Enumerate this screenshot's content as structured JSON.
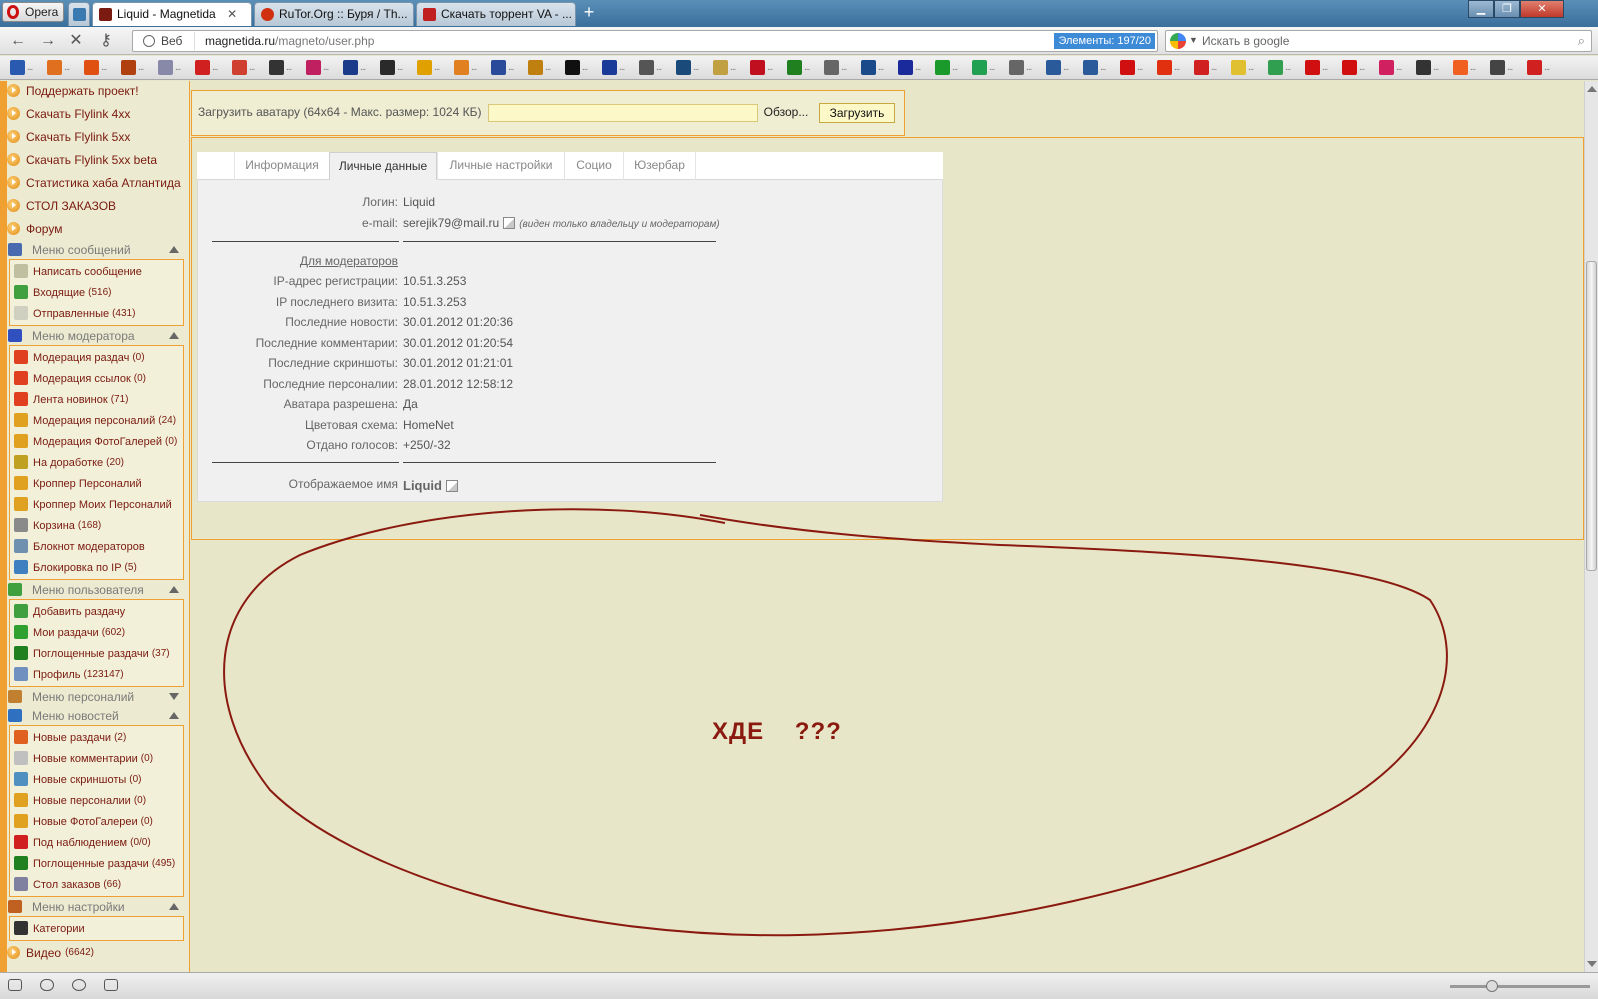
{
  "browser": {
    "menu_label": "Opera",
    "tabs": [
      {
        "label": "Liquid - Magnetida",
        "active": true,
        "color": "#7a1a10"
      },
      {
        "label": "RuTor.Org :: Буря / Th...",
        "active": false,
        "color": "#d03010"
      },
      {
        "label": "Скачать торрент VA - ...",
        "active": false,
        "color": "#c02020"
      }
    ],
    "new_tab": "+",
    "address": {
      "scheme_label": "Веб",
      "host": "magnetida.ru",
      "path": "/magneto/user.php",
      "counter": "Элементы: 197/20"
    },
    "search_placeholder": "Искать в google"
  },
  "bookmark_colors": [
    "#2a5ab0",
    "#e07020",
    "#e05010",
    "#b04010",
    "#8888a8",
    "#d02020",
    "#d04030",
    "#333333",
    "#c02060",
    "#1a3a8a",
    "#2a2a2a",
    "#e0a000",
    "#e08020",
    "#2a4a9a",
    "#c08010",
    "#101010",
    "#1a3a9a",
    "#555555",
    "#1a4a7a",
    "#c0a040",
    "#c01020",
    "#208020",
    "#666666",
    "#1a4a8a",
    "#1a2a9a",
    "#1a9a2a",
    "#20a050",
    "#666666",
    "#2a5a9a",
    "#2a5a9a",
    "#d01010",
    "#e03010",
    "#d02020",
    "#e0c030",
    "#30a050",
    "#d01010",
    "#d01010",
    "#d02060",
    "#333333",
    "#f06020",
    "#444444",
    "#d02020"
  ],
  "sidebar": {
    "top_links": [
      "Поддержать проект!",
      "Скачать Flylink 4xx",
      "Скачать Flylink 5xx",
      "Скачать Flylink 5xx beta",
      "Статистика хаба Атлантида",
      "СТОЛ ЗАКАЗОВ",
      "Форум"
    ],
    "menus": [
      {
        "title": "Меню сообщений",
        "open": true,
        "color": "#4a6ab0",
        "items": [
          {
            "label": "Написать сообщение",
            "count": "",
            "color": "#c0c0a0"
          },
          {
            "label": "Входящие",
            "count": "(516)",
            "color": "#40a040"
          },
          {
            "label": "Отправленные",
            "count": "(431)",
            "color": "#d0d0c0"
          }
        ]
      },
      {
        "title": "Меню модератора",
        "open": true,
        "color": "#3050c0",
        "items": [
          {
            "label": "Модерация раздач",
            "count": "(0)",
            "color": "#e04020"
          },
          {
            "label": "Модерация ссылок",
            "count": "(0)",
            "color": "#e04020"
          },
          {
            "label": "Лента новинок",
            "count": "(71)",
            "color": "#e04020"
          },
          {
            "label": "Модерация персоналий",
            "count": "(24)",
            "color": "#e0a020"
          },
          {
            "label": "Модерация ФотоГалерей",
            "count": "(0)",
            "color": "#e0a020"
          },
          {
            "label": "На доработке",
            "count": "(20)",
            "color": "#c0a020"
          },
          {
            "label": "Кроппер Персоналий",
            "count": "",
            "color": "#e0a020"
          },
          {
            "label": "Кроппер Моих Персоналий",
            "count": "",
            "color": "#e0a020"
          },
          {
            "label": "Корзина",
            "count": "(168)",
            "color": "#8a8a8a"
          },
          {
            "label": "Блокнот модераторов",
            "count": "",
            "color": "#7090b0"
          },
          {
            "label": "Блокировка по IP",
            "count": "(5)",
            "color": "#4080c0"
          }
        ]
      },
      {
        "title": "Меню пользователя",
        "open": true,
        "color": "#40a040",
        "items": [
          {
            "label": "Добавить раздачу",
            "count": "",
            "color": "#40a040"
          },
          {
            "label": "Мои раздачи",
            "count": "(602)",
            "color": "#30a030"
          },
          {
            "label": "Поглощенные раздачи",
            "count": "(37)",
            "color": "#208020"
          },
          {
            "label": "Профиль",
            "count": "(123147)",
            "color": "#7090c0"
          }
        ]
      },
      {
        "title": "Меню персоналий",
        "open": false,
        "color": "#c08030",
        "items": []
      },
      {
        "title": "Меню новостей",
        "open": true,
        "color": "#3070c0",
        "items": [
          {
            "label": "Новые раздачи",
            "count": "(2)",
            "color": "#e06020"
          },
          {
            "label": "Новые комментарии",
            "count": "(0)",
            "color": "#c0c0c0"
          },
          {
            "label": "Новые скриншоты",
            "count": "(0)",
            "color": "#5090c0"
          },
          {
            "label": "Новые персоналии",
            "count": "(0)",
            "color": "#e0a020"
          },
          {
            "label": "Новые ФотоГалереи",
            "count": "(0)",
            "color": "#e0a020"
          },
          {
            "label": "Под наблюдением",
            "count": "(0/0)",
            "color": "#d02020"
          },
          {
            "label": "Поглощенные раздачи",
            "count": "(495)",
            "color": "#208020"
          },
          {
            "label": "Стол заказов",
            "count": "(66)",
            "color": "#8080a0"
          }
        ]
      },
      {
        "title": "Меню настройки",
        "open": true,
        "color": "#c06020",
        "items": [
          {
            "label": "Категории",
            "count": "",
            "color": "#333333"
          }
        ]
      }
    ],
    "bottom_link": {
      "label": "Видео",
      "count": "(6642)"
    }
  },
  "avatar_upload": {
    "label": "Загрузить аватару (64x64 - Макс. размер: 1024 КБ)",
    "browse_label": "Обзор...",
    "upload_label": "Загрузить"
  },
  "profile_tabs": [
    "Информация",
    "Личные данные",
    "Личные настройки",
    "Социо",
    "Юзербар"
  ],
  "profile": {
    "login_label": "Логин:",
    "login": "Liquid",
    "email_label": "e-mail:",
    "email": "serejik79@mail.ru",
    "email_note": "(виден только владельцу и модераторам)",
    "moderators_header": "Для модераторов",
    "mod_fields": [
      {
        "label": "IP-адрес регистрации:",
        "value": "10.51.3.253"
      },
      {
        "label": "IP последнего визита:",
        "value": "10.51.3.253"
      },
      {
        "label": "Последние новости:",
        "value": "30.01.2012 01:20:36"
      },
      {
        "label": "Последние комментарии:",
        "value": "30.01.2012 01:20:54"
      },
      {
        "label": "Последние скриншоты:",
        "value": "30.01.2012 01:21:01"
      },
      {
        "label": "Последние персоналии:",
        "value": "28.01.2012 12:58:12"
      },
      {
        "label": "Аватара разрешена:",
        "value": "Да"
      },
      {
        "label": "Цветовая схема:",
        "value": "HomeNet"
      },
      {
        "label": "Отдано голосов:",
        "value": "+250/-32"
      }
    ],
    "display_name_label": "Отображаемое имя",
    "display_name": "Liquid"
  },
  "annotation": {
    "text": "ХДЕ    ???",
    "color": "#8a1a10"
  }
}
